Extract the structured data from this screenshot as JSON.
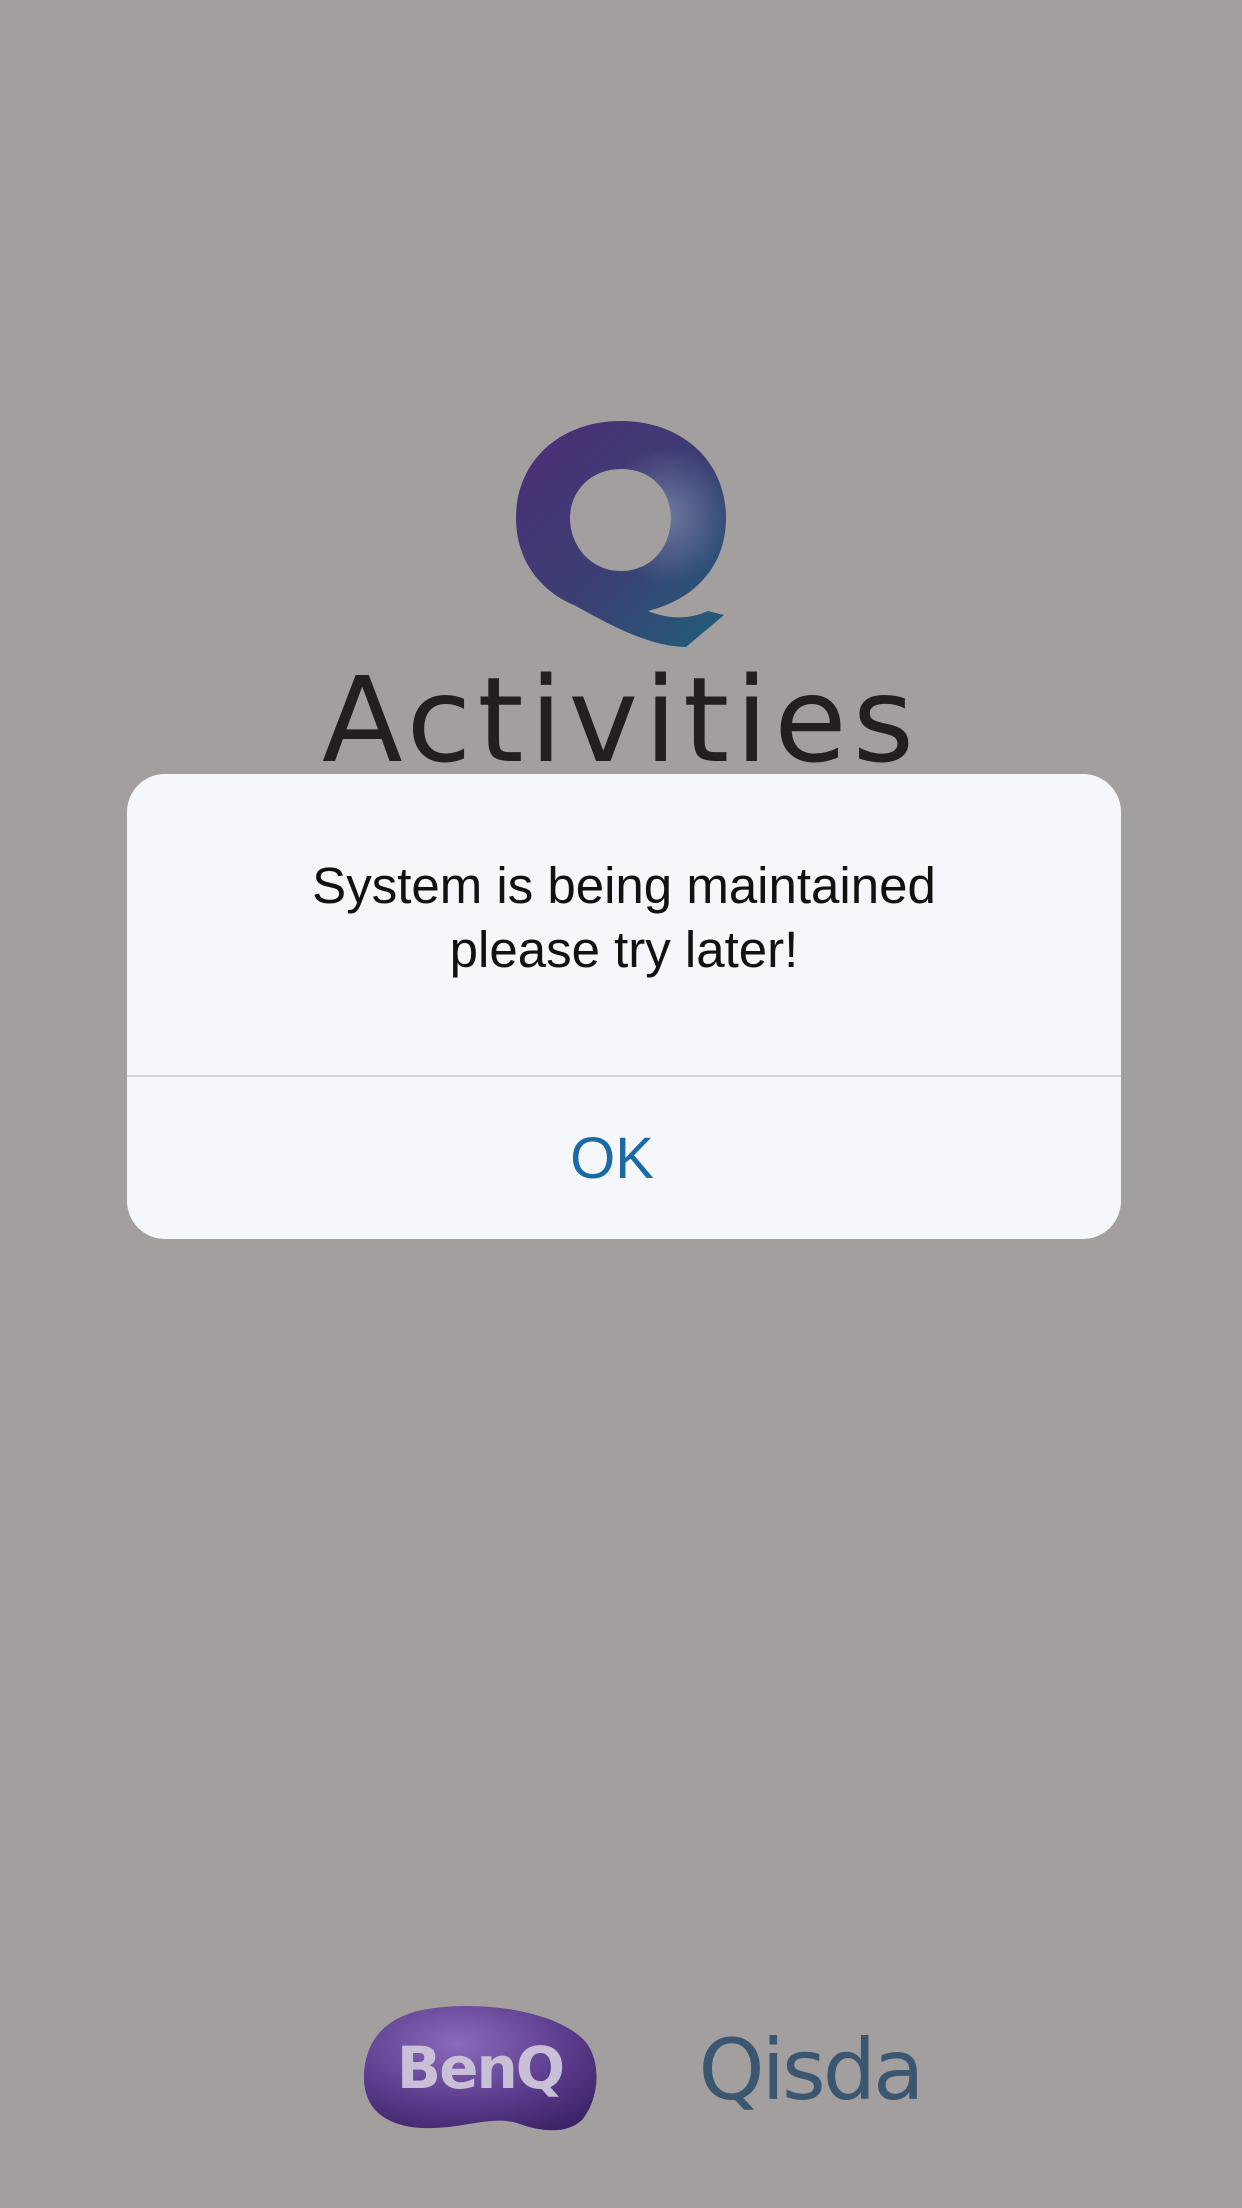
{
  "splash": {
    "app_name": "Activities",
    "logo_letter": "Q",
    "logo_icon": "q-activities-logo-icon",
    "wordmark_color": "#231f20",
    "background_color": "#a39f9f"
  },
  "alert": {
    "message": "System is being maintained\nplease try later!",
    "ok_label": "OK",
    "ok_color": "#1a6aa8",
    "background_color": "#f6f7fa"
  },
  "footer": {
    "brand_left": "BenQ",
    "brand_left_icon": "benq-logo-icon",
    "brand_left_color": "#5b3b8c",
    "brand_right": "Qisda",
    "brand_right_icon": "qisda-logo-icon",
    "brand_right_color": "#3a5670"
  }
}
